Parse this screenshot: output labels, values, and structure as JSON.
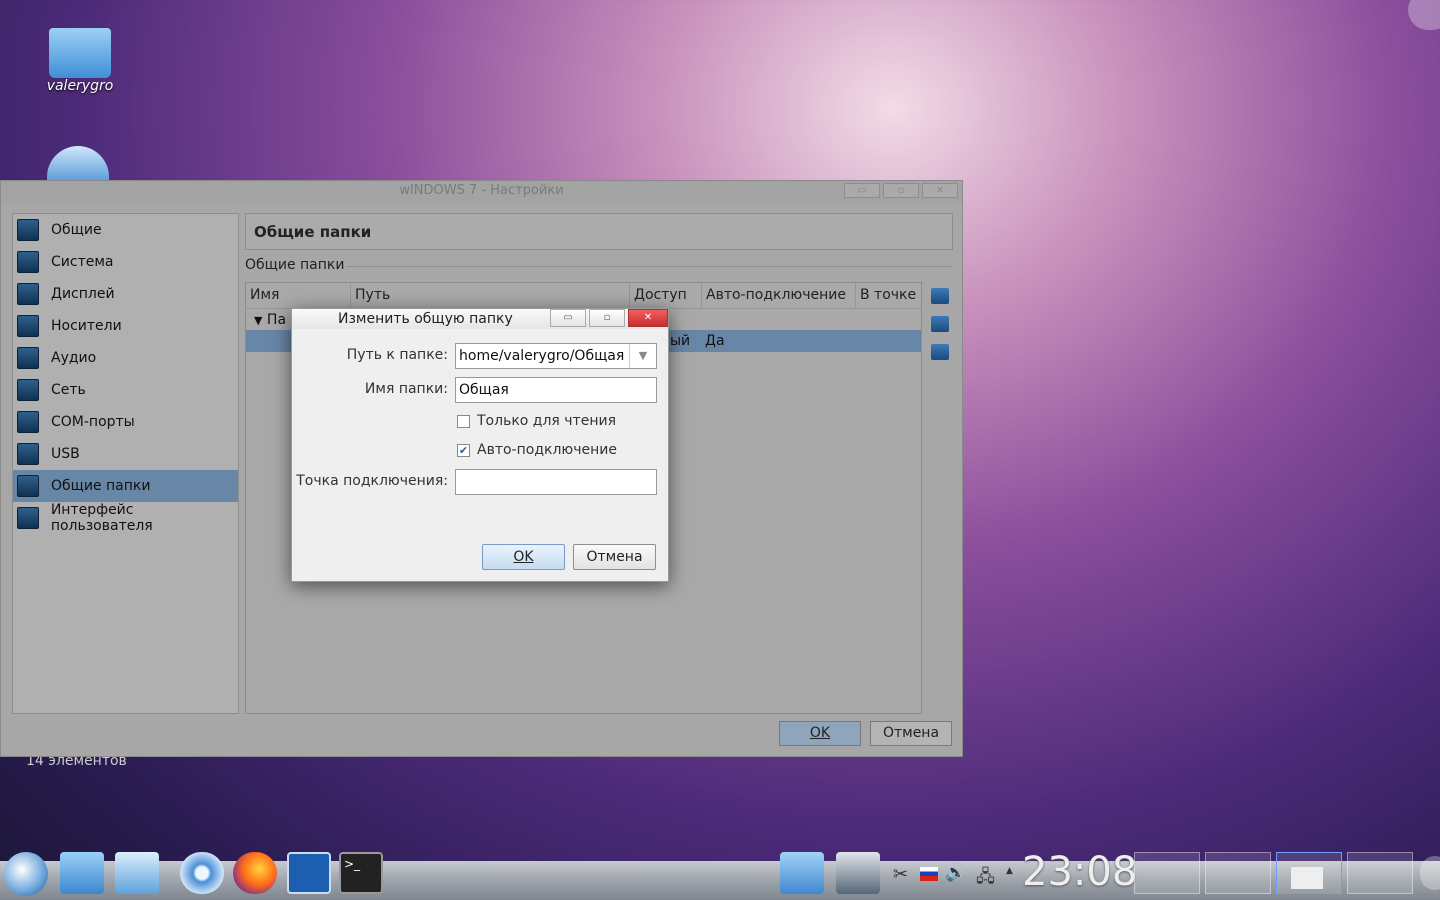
{
  "desktop": {
    "icons": [
      {
        "label": "valerygro"
      }
    ],
    "status": "14 элементов"
  },
  "window": {
    "title": "wINDOWS 7 - Настройки",
    "sidebar": [
      "Общие",
      "Система",
      "Дисплей",
      "Носители",
      "Аудио",
      "Сеть",
      "COM-порты",
      "USB",
      "Общие папки",
      "Интерфейс пользователя"
    ],
    "header": "Общие папки",
    "group": "Общие папки",
    "columns": [
      "Имя",
      "Путь",
      "Доступ",
      "Авто-подключение",
      "В точке"
    ],
    "rows": [
      {
        "name": "Па"
      },
      {
        "access": "ый",
        "auto": "Да"
      }
    ],
    "ok": "OK",
    "cancel": "Отмена"
  },
  "dialog": {
    "title": "Изменить общую папку",
    "path_label": "Путь к папке:",
    "path_value": "home/valerygro/Общая",
    "name_label": "Имя папки:",
    "name_value": "Общая",
    "readonly_label": "Только для чтения",
    "auto_label": "Авто-подключение",
    "mount_label": "Точка подключения:",
    "mount_value": "",
    "ok": "OK",
    "cancel": "Отмена"
  },
  "taskbar": {
    "clock": "23:08"
  }
}
